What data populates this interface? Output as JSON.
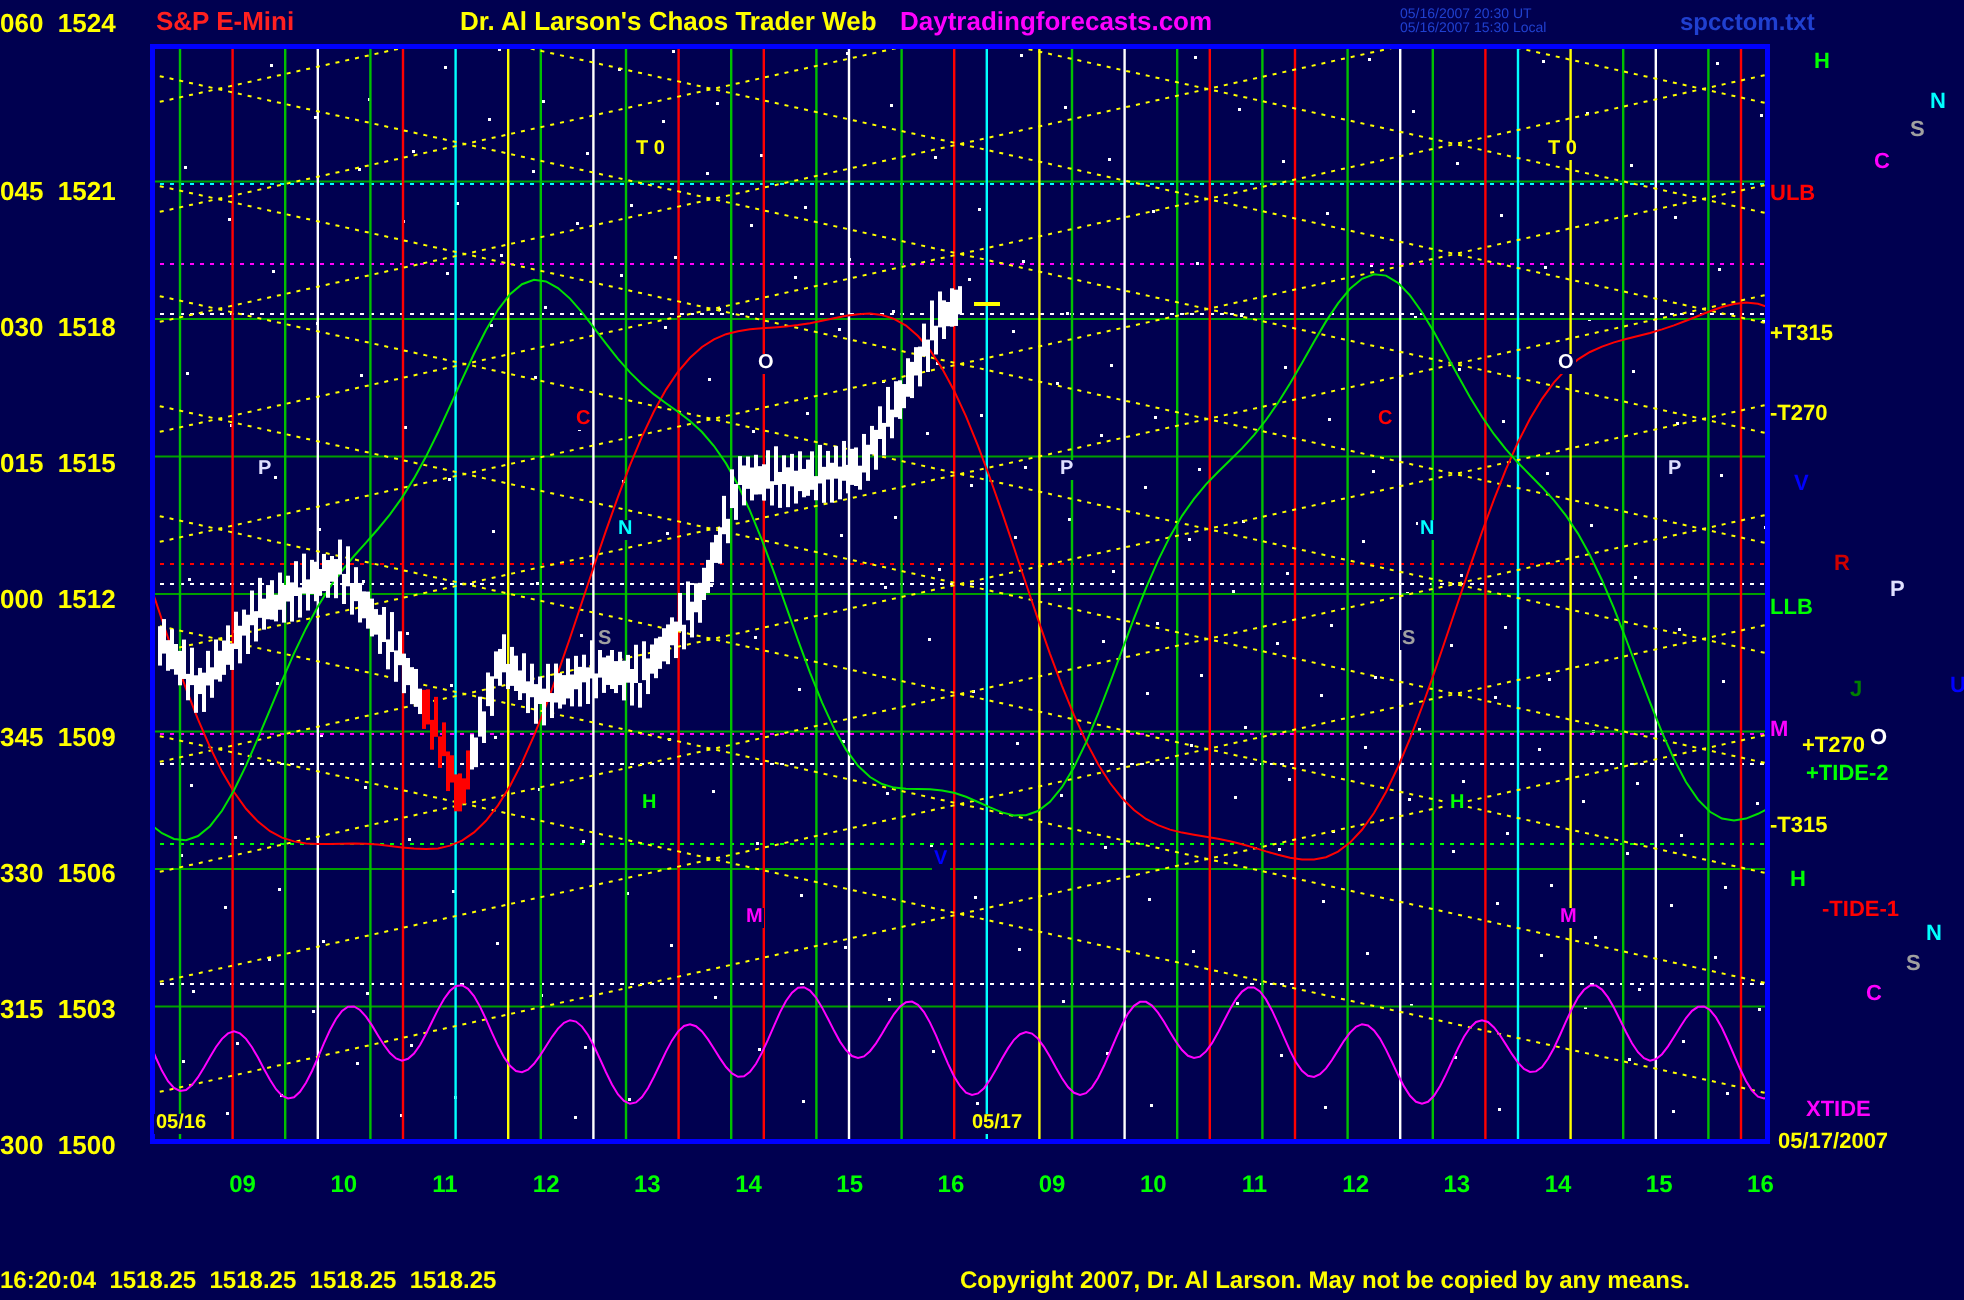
{
  "header": {
    "axis_top": "060  1524",
    "symbol": "S&P E-Mini",
    "title": "Dr. Al Larson's Chaos Trader Web",
    "site": "Daytradingforecasts.com",
    "time_ut": "05/16/2007 20:30 UT",
    "time_local": "05/16/2007 15:30 Local",
    "file": "spcctom.txt"
  },
  "y_axis": [
    "045  1521",
    "030  1518",
    "015  1515",
    "000  1512",
    "345  1509",
    "330  1506",
    "315  1503",
    "300  1500"
  ],
  "chart_markers": [
    {
      "text": "T 0",
      "color": "#ffff00"
    },
    {
      "text": "T 0",
      "color": "#ffff00"
    },
    {
      "text": "O",
      "color": "#ffffff"
    },
    {
      "text": "O",
      "color": "#ffffff"
    },
    {
      "text": "P",
      "color": "#e0e0ff"
    },
    {
      "text": "P",
      "color": "#e0e0ff"
    },
    {
      "text": "P",
      "color": "#e0e0ff"
    },
    {
      "text": "C",
      "color": "#ff0000"
    },
    {
      "text": "C",
      "color": "#ff0000"
    },
    {
      "text": "N",
      "color": "#00ffff"
    },
    {
      "text": "N",
      "color": "#00ffff"
    },
    {
      "text": "S",
      "color": "#a0a0a0"
    },
    {
      "text": "S",
      "color": "#a0a0a0"
    },
    {
      "text": "H",
      "color": "#00ff00"
    },
    {
      "text": "H",
      "color": "#00ff00"
    },
    {
      "text": "M",
      "color": "#ff00ff"
    },
    {
      "text": "M",
      "color": "#ff00ff"
    },
    {
      "text": "V",
      "color": "#0000ff"
    },
    {
      "text": "05/16",
      "color": "#ffff00"
    },
    {
      "text": "05/17",
      "color": "#ffff00"
    }
  ],
  "side_labels": [
    {
      "text": "H",
      "color": "#00ff00"
    },
    {
      "text": "N",
      "color": "#00ffff"
    },
    {
      "text": "S",
      "color": "#a0a0a0"
    },
    {
      "text": "C",
      "color": "#ff00ff"
    },
    {
      "text": "ULB",
      "color": "#ff0000"
    },
    {
      "text": "+T315",
      "color": "#ffff00"
    },
    {
      "text": "-T270",
      "color": "#ffff00"
    },
    {
      "text": "V",
      "color": "#0000ff"
    },
    {
      "text": "R",
      "color": "#d00000"
    },
    {
      "text": "P",
      "color": "#e0e0ff"
    },
    {
      "text": "LLB",
      "color": "#00ff00"
    },
    {
      "text": "J",
      "color": "#008000"
    },
    {
      "text": "U",
      "color": "#0000ff"
    },
    {
      "text": "M",
      "color": "#ff00ff"
    },
    {
      "text": "+T270",
      "color": "#ffff00"
    },
    {
      "text": "O",
      "color": "#ffffff"
    },
    {
      "text": "+TIDE-2",
      "color": "#00ff00"
    },
    {
      "text": "-T315",
      "color": "#ffff00"
    },
    {
      "text": "H",
      "color": "#00ff00"
    },
    {
      "text": "-TIDE-1",
      "color": "#ff0000"
    },
    {
      "text": "N",
      "color": "#00ffff"
    },
    {
      "text": "S",
      "color": "#a0a0a0"
    },
    {
      "text": "C",
      "color": "#ff00ff"
    },
    {
      "text": "XTIDE",
      "color": "#ff00ff"
    },
    {
      "text": "05/17/2007",
      "color": "#ffff00"
    }
  ],
  "x_axis": [
    "09",
    "10",
    "11",
    "12",
    "13",
    "14",
    "15",
    "16",
    "09",
    "10",
    "11",
    "12",
    "13",
    "14",
    "15",
    "16"
  ],
  "footer": {
    "quote": "16:20:04  1518.25  1518.25  1518.25  1518.25",
    "copyright": "Copyright 2007, Dr. Al Larson. May not be copied by any means."
  }
}
